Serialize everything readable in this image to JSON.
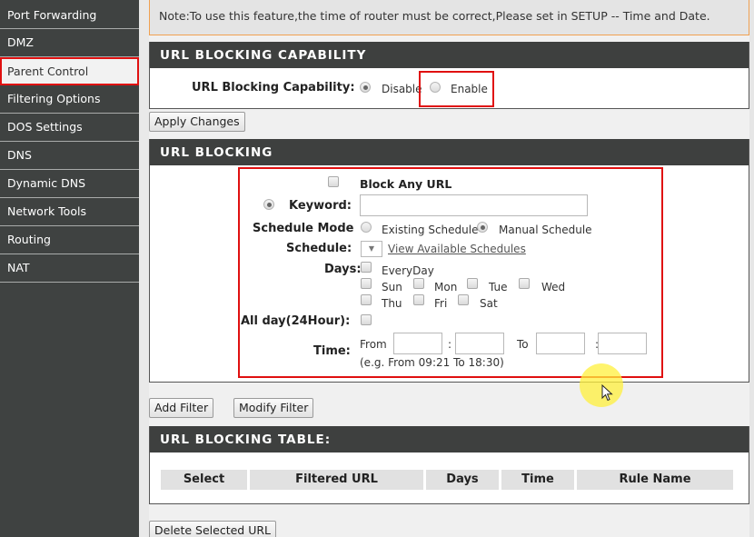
{
  "sidebar": {
    "items": [
      {
        "label": "Port Forwarding",
        "active": false
      },
      {
        "label": "DMZ",
        "active": false
      },
      {
        "label": "Parent Control",
        "active": true
      },
      {
        "label": "Filtering Options",
        "active": false
      },
      {
        "label": "DOS Settings",
        "active": false
      },
      {
        "label": "DNS",
        "active": false
      },
      {
        "label": "Dynamic DNS",
        "active": false
      },
      {
        "label": "Network Tools",
        "active": false
      },
      {
        "label": "Routing",
        "active": false
      },
      {
        "label": "NAT",
        "active": false
      }
    ]
  },
  "note": "Note:To use this feature,the time of router must be correct,Please set in SETUP -- Time and Date.",
  "capability": {
    "header": "URL BLOCKING CAPABILITY",
    "label": "URL Blocking Capability:",
    "options": [
      {
        "label": "Disable",
        "checked": true
      },
      {
        "label": "Enable",
        "checked": false
      }
    ],
    "apply_label": "Apply Changes"
  },
  "blocking": {
    "header": "URL BLOCKING",
    "block_any_label": "Block Any URL",
    "block_any_checked": false,
    "keyword_label": "Keyword:",
    "keyword_value": "",
    "keyword_selected": true,
    "schedule_mode_label": "Schedule Mode",
    "schedule_mode_options": [
      {
        "label": "Existing Schedule",
        "checked": false
      },
      {
        "label": "Manual Schedule",
        "checked": true
      }
    ],
    "schedule_label": "Schedule:",
    "schedule_value": "",
    "view_schedules_link": "View Available Schedules",
    "days_label": "Days:",
    "days": {
      "everyday": "EveryDay",
      "sun": "Sun",
      "mon": "Mon",
      "tue": "Tue",
      "wed": "Wed",
      "thu": "Thu",
      "fri": "Fri",
      "sat": "Sat"
    },
    "all_day_label": "All day(24Hour):",
    "time_label": "Time:",
    "from_label": "From",
    "to_label": "To",
    "colon": ":",
    "time_hint": "(e.g. From 09:21 To 18:30)",
    "from_hour": "",
    "from_min": "",
    "to_hour": "",
    "to_min": ""
  },
  "actions": {
    "add_filter": "Add Filter",
    "modify_filter": "Modify Filter",
    "delete_selected": "Delete Selected URL"
  },
  "table": {
    "header": "URL BLOCKING TABLE:",
    "columns": [
      "Select",
      "Filtered URL",
      "Days",
      "Time",
      "Rule Name"
    ],
    "rows": []
  },
  "colors": {
    "sidebar_bg": "#3f4241",
    "panel_header_bg": "#3e403f",
    "highlight_red": "#e01010",
    "note_border": "#f0a050"
  }
}
